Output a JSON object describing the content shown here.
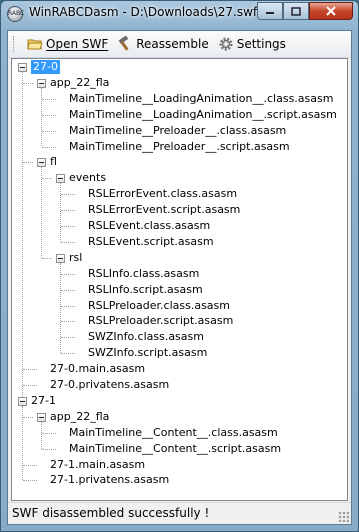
{
  "window": {
    "title": "WinRABCDasm - D:\\Downloads\\27.swf",
    "app_icon_text": "RABC"
  },
  "caption_buttons": {
    "minimize": "minimize",
    "maximize": "maximize",
    "close": "close"
  },
  "toolbar": {
    "open_label": "Open SWF",
    "reassemble_label": "Reassemble",
    "settings_label": "Settings"
  },
  "tree": {
    "nodes": [
      "27-0",
      "app_22_fla",
      "MainTimeline__LoadingAnimation__.class.asasm",
      "MainTimeline__LoadingAnimation__.script.asasm",
      "MainTimeline__Preloader__.class.asasm",
      "MainTimeline__Preloader__.script.asasm",
      "fl",
      "events",
      "RSLErrorEvent.class.asasm",
      "RSLErrorEvent.script.asasm",
      "RSLEvent.class.asasm",
      "RSLEvent.script.asasm",
      "rsl",
      "RSLInfo.class.asasm",
      "RSLInfo.script.asasm",
      "RSLPreloader.class.asasm",
      "RSLPreloader.script.asasm",
      "SWZInfo.class.asasm",
      "SWZInfo.script.asasm",
      "27-0.main.asasm",
      "27-0.privatens.asasm",
      "27-1",
      "app_22_fla",
      "MainTimeline__Content__.class.asasm",
      "MainTimeline__Content__.script.asasm",
      "27-1.main.asasm",
      "27-1.privatens.asasm"
    ],
    "selected": "27-0"
  },
  "status": {
    "text": "SWF disassembled successfully !"
  }
}
